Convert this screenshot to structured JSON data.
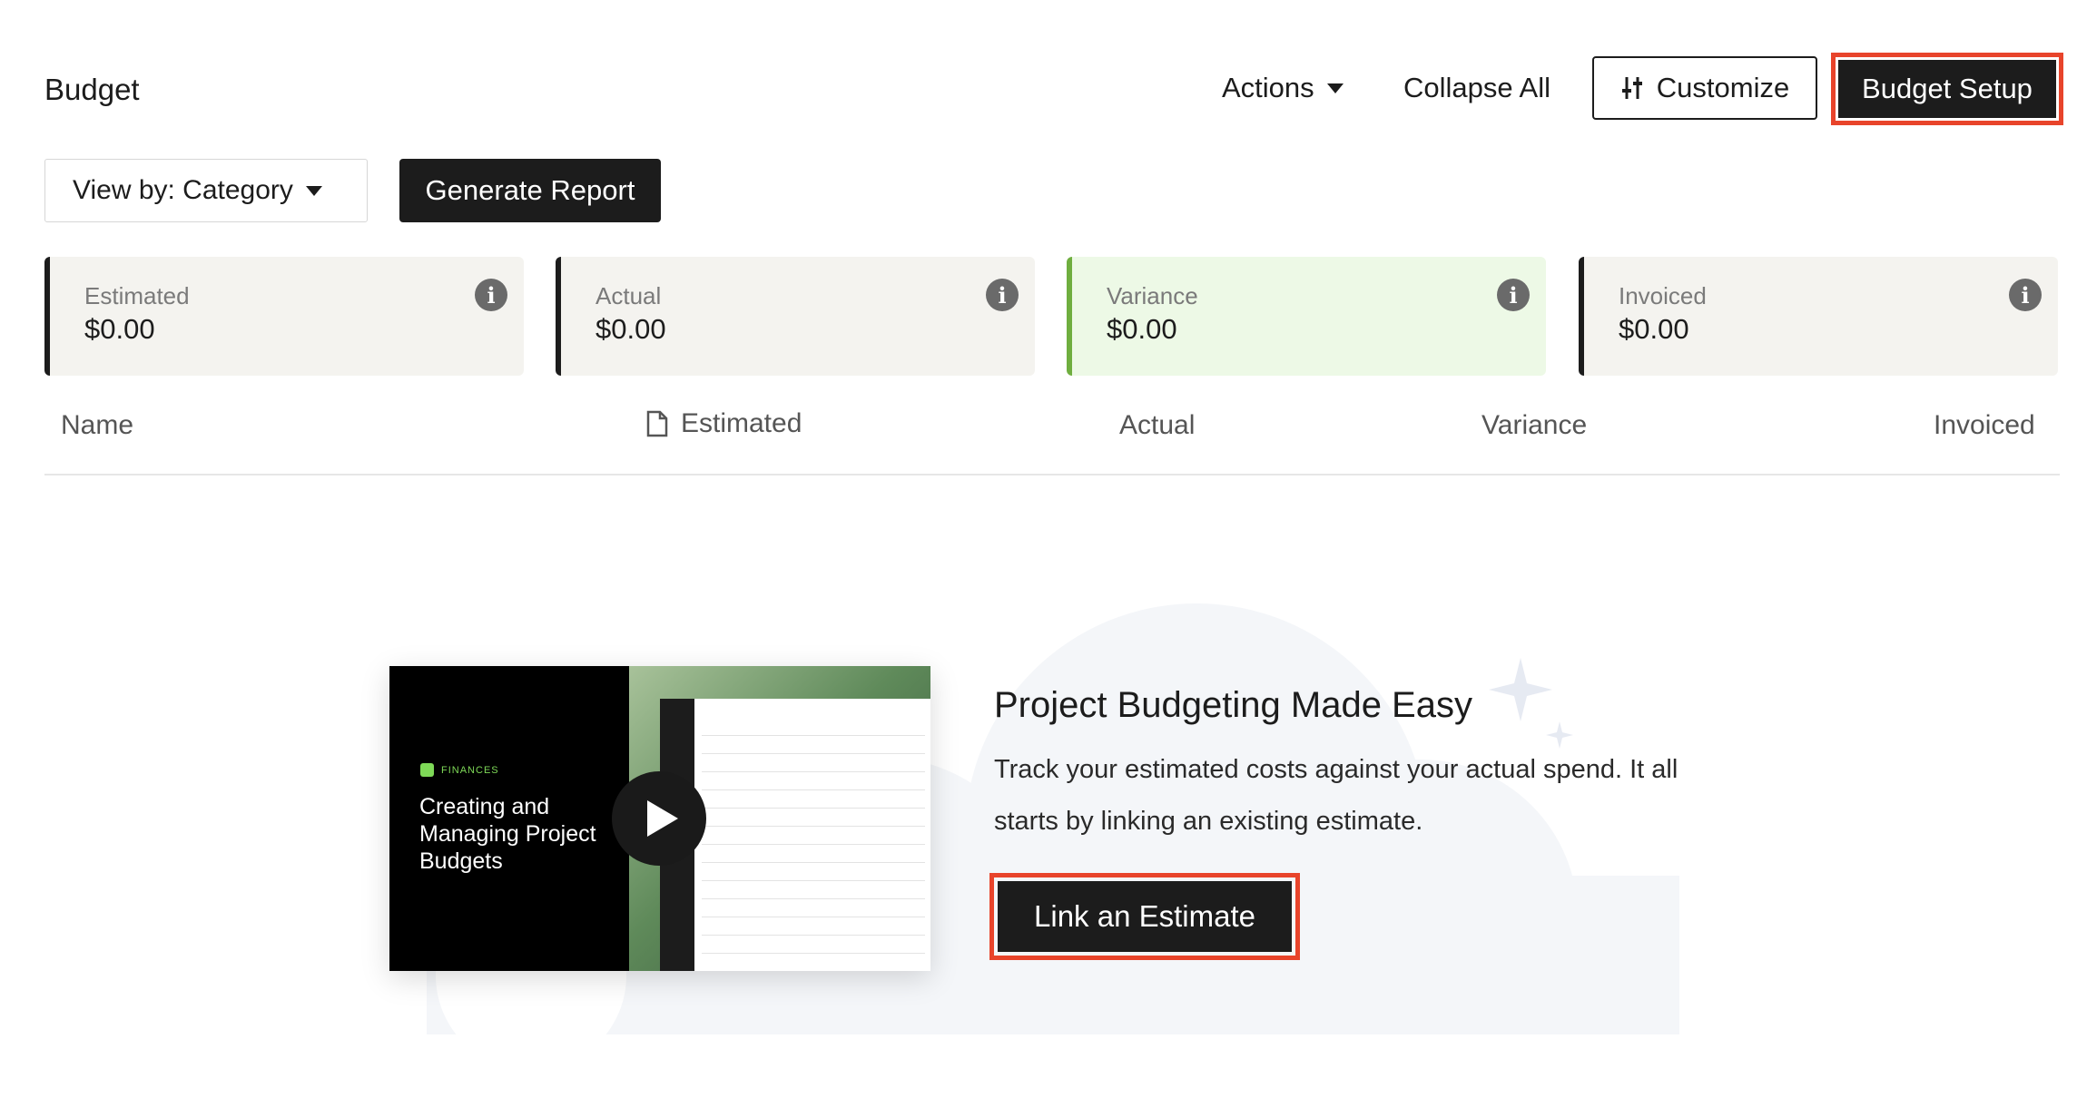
{
  "header": {
    "title": "Budget",
    "actions_label": "Actions",
    "collapse_label": "Collapse All",
    "customize_label": "Customize",
    "budget_setup_label": "Budget Setup"
  },
  "toolbar": {
    "view_by_label": "View by: Category",
    "generate_report_label": "Generate Report"
  },
  "summary_cards": [
    {
      "label": "Estimated",
      "value": "$0.00"
    },
    {
      "label": "Actual",
      "value": "$0.00"
    },
    {
      "label": "Variance",
      "value": "$0.00"
    },
    {
      "label": "Invoiced",
      "value": "$0.00"
    }
  ],
  "table": {
    "columns": [
      "Name",
      "Estimated",
      "Actual",
      "Variance",
      "Invoiced"
    ]
  },
  "promo": {
    "video_badge": "FINANCES",
    "video_title": "Creating and Managing Project Budgets",
    "title": "Project Budgeting Made Easy",
    "body": "Track your estimated costs against your actual spend. It all starts by linking an existing estimate.",
    "cta_label": "Link an Estimate"
  },
  "colors": {
    "accent_dark": "#1c1c1c",
    "highlight_border": "#e8442b",
    "variance_green": "#6fae3f"
  }
}
